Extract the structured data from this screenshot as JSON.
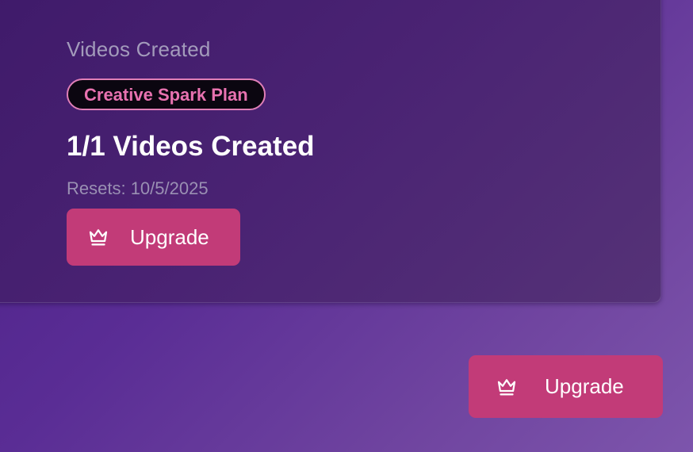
{
  "card": {
    "label": "Videos Created",
    "plan_badge": "Creative Spark Plan",
    "usage_title": "1/1 Videos Created",
    "resets": "Resets: 10/5/2025",
    "upgrade_button": {
      "label": "Upgrade",
      "icon": "crown-icon"
    }
  },
  "corner_upgrade_button": {
    "label": "Upgrade",
    "icon": "crown-icon"
  },
  "colors": {
    "accent_button": "#c23b78",
    "badge_border": "#e07fb7",
    "badge_text": "#e872b0",
    "card_background": "#44206f",
    "page_background": "#5a2d95"
  }
}
